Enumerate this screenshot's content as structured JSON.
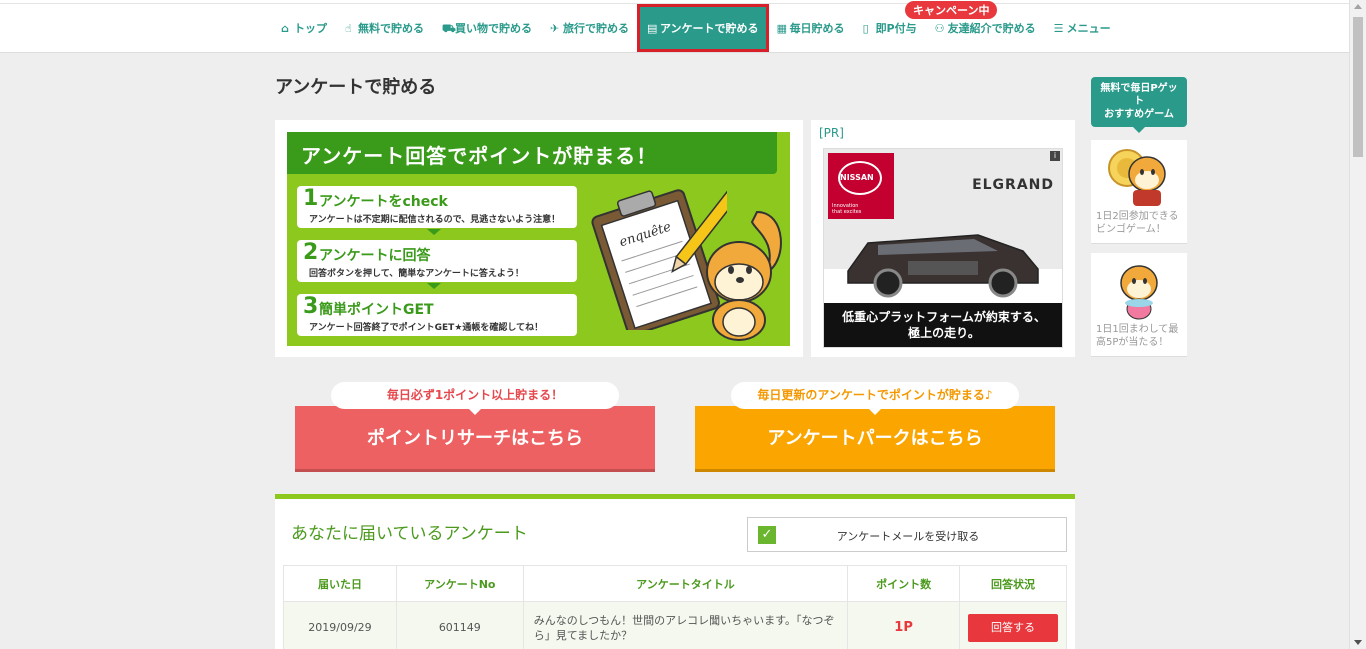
{
  "nav": {
    "campaign_badge": "キャンペーン中",
    "items": [
      {
        "label": "トップ",
        "icon": "home-icon"
      },
      {
        "label": "無料で貯める",
        "icon": "hand-icon"
      },
      {
        "label": "買い物で貯める",
        "icon": "cart-icon"
      },
      {
        "label": "旅行で貯める",
        "icon": "plane-icon"
      },
      {
        "label": "アンケートで貯める",
        "icon": "clipboard-icon"
      },
      {
        "label": "毎日貯める",
        "icon": "calendar-icon"
      },
      {
        "label": "即P付与",
        "icon": "book-icon"
      },
      {
        "label": "友達紹介で貯める",
        "icon": "friends-icon"
      },
      {
        "label": "メニュー",
        "icon": "menu-icon"
      }
    ]
  },
  "main": {
    "page_title": "アンケートで貯める",
    "banner": {
      "headline": "アンケート回答でポイントが貯まる！",
      "steps": [
        {
          "num": "1",
          "title": "アンケートをcheck",
          "text": "アンケートは不定期に配信されるので、見逃さないよう注意！"
        },
        {
          "num": "2",
          "title": "アンケートに回答",
          "text": "回答ボタンを押して、簡単なアンケートに答えよう！"
        },
        {
          "num": "3",
          "title": "簡単ポイントGET",
          "text": "アンケート回答終了でポイントGET★通帳を確認してね！"
        }
      ],
      "clipboard_text": "enquête"
    },
    "pr": {
      "label": "[PR]",
      "logo": "NISSAN",
      "logo_sub1": "Innovation",
      "logo_sub2": "that excites",
      "brand": "ELGRAND",
      "copy_line1": "低重心プラットフォームが約束する、",
      "copy_line2": "極上の走り。",
      "info": "i"
    },
    "cta": {
      "red": {
        "bubble": "毎日必ず1ポイント以上貯まる！",
        "button": "ポイントリサーチはこちら"
      },
      "orange": {
        "bubble": "毎日更新のアンケートでポイントが貯まる♪",
        "button": "アンケートパークはこちら"
      }
    },
    "survey": {
      "title": "あなたに届いているアンケート",
      "mail_option": "アンケートメールを受け取る",
      "columns": [
        "届いた日",
        "アンケートNo",
        "アンケートタイトル",
        "ポイント数",
        "回答状況"
      ],
      "rows": [
        {
          "date": "2019/09/29",
          "no": "601149",
          "title": "みんなのしつもん！世間のアレコレ聞いちゃいます。「なつぞら」見てましたか？",
          "points": "1P",
          "action": "回答する"
        }
      ]
    }
  },
  "side": {
    "header": "無料で毎日Pゲット\nおすすめゲーム",
    "header_line1": "無料で毎日Pゲッ",
    "header_line2": "ト",
    "header_line3": "おすすめゲーム",
    "games": [
      {
        "text": "1日2回参加できるビンゴゲーム！"
      },
      {
        "text": "1日1回まわして最高5Pが当たる！"
      }
    ]
  },
  "colors": {
    "accent": "#2a9a8b",
    "green": "#8cc81e",
    "red": "#ee6162",
    "orange": "#fba500",
    "alert": "#e8383d"
  }
}
